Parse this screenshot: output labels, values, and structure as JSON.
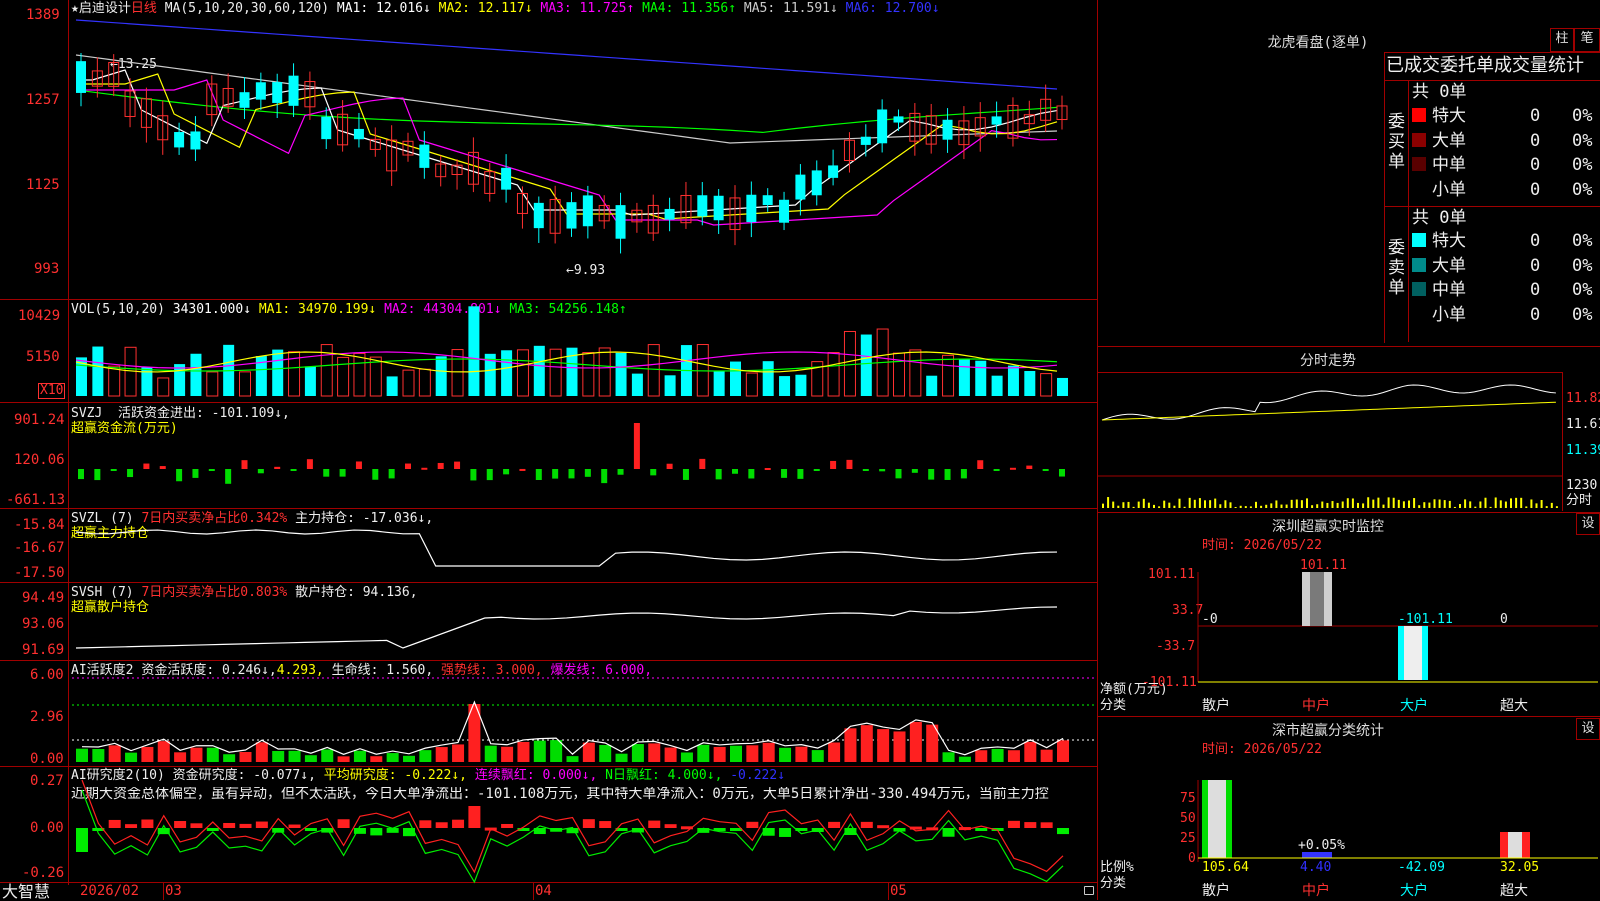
{
  "chart": {
    "stock_name": "启迪设计",
    "period": "日线",
    "ma_title": "MA(5,10,20,30,60,120)",
    "ma": [
      {
        "label": "MA1: 12.016↓",
        "color": "#ffffff"
      },
      {
        "label": "MA2: 12.117↓",
        "color": "#ffff00"
      },
      {
        "label": "MA3: 11.725↑",
        "color": "#ff00ff"
      },
      {
        "label": "MA4: 11.356↑",
        "color": "#00ff00"
      },
      {
        "label": "MA5: 11.591↓",
        "color": "#cccccc"
      },
      {
        "label": "MA6: 12.700↓",
        "color": "#3333ff"
      }
    ],
    "price_ticks": [
      "1389",
      "1257",
      "1125",
      "993"
    ],
    "high_mark": "13.25",
    "low_mark": "9.93",
    "vol_title": "VOL(5,10,20)",
    "vol_labels": [
      {
        "label": "34301.000↓",
        "color": "#ffffff"
      },
      {
        "label": "MA1: 34970.199↓",
        "color": "#ffff00"
      },
      {
        "label": "MA2: 44304.801↓",
        "color": "#ff00ff"
      },
      {
        "label": "MA3: 54256.148↑",
        "color": "#00ff00"
      }
    ],
    "vol_ticks": [
      "10429",
      "5150"
    ],
    "vol_unit": "X10",
    "svzj": {
      "title": "SVZJ",
      "label": "活跃资金进出: -101.109↓,",
      "name": "超赢资金流(万元)",
      "ticks": [
        "901.24",
        "120.06",
        "-661.13"
      ]
    },
    "svzl": {
      "title": "SVZL (7)",
      "ratio": "7日内买卖净占比0.342%",
      "label": "主力持仓: -17.036↓,",
      "name": "超赢主力持仓",
      "ticks": [
        "-15.84",
        "-16.67",
        "-17.50"
      ]
    },
    "svsh": {
      "title": "SVSH (7)",
      "ratio": "7日内买卖净占比0.803%",
      "label": "散户持仓: 94.136,",
      "name": "超赢散户持仓",
      "ticks": [
        "94.49",
        "93.06",
        "91.69"
      ]
    },
    "ai1": {
      "title": "AI活跃度2",
      "l1": "资金活跃度: 0.246↓,",
      "l2": "4.293,",
      "l3": "生命线: 1.560,",
      "l4": "强势线: 3.000,",
      "l5": "爆发线: 6.000,",
      "ticks": [
        "6.00",
        "2.96",
        "0.00"
      ]
    },
    "ai2": {
      "title": "AI研究度2(10)",
      "l1": "资金研究度: -0.077↓,",
      "l2": "平均研究度: -0.222↓,",
      "l3": "连续飘红: 0.000↓,",
      "l4": "N日飘红: 4.000↓,",
      "l5": "-0.222↓",
      "comment": "近期大资金总体偏空，虽有异动，但不太活跃，今日大单净流出：-101.108万元，其中特大单净流入：0万元，大单5日累计净出-330.494万元，当前主力控",
      "ticks": [
        "0.27",
        "0.00",
        "-0.26"
      ]
    },
    "dates": [
      "2026/02",
      "03",
      "04",
      "05"
    ],
    "brand": "大智慧"
  },
  "side": {
    "lhb_title": "龙虎看盘(逐单)",
    "btn_zhu": "柱",
    "btn_bi": "笔",
    "tabs": "已成交委托单成交量统计",
    "buy_vlabel": "委买单",
    "sell_vlabel": "委卖单",
    "buy_total": "共 0单",
    "sell_total": "共 0单",
    "buy_rows": [
      {
        "name": "特大",
        "val": "0",
        "pct": "0%",
        "color": "#ff0000"
      },
      {
        "name": "大单",
        "val": "0",
        "pct": "0%",
        "color": "#8b0000"
      },
      {
        "name": "中单",
        "val": "0",
        "pct": "0%",
        "color": "#5a0000"
      },
      {
        "name": "小单",
        "val": "0",
        "pct": "0%",
        "color": "#000000"
      }
    ],
    "sell_rows": [
      {
        "name": "特大",
        "val": "0",
        "pct": "0%",
        "color": "#00ffff"
      },
      {
        "name": "大单",
        "val": "0",
        "pct": "0%",
        "color": "#008b8b"
      },
      {
        "name": "中单",
        "val": "0",
        "pct": "0%",
        "color": "#006060"
      },
      {
        "name": "小单",
        "val": "0",
        "pct": "0%",
        "color": "#000000"
      }
    ],
    "fenshi_title": "分时走势",
    "fenshi_ticks": [
      "11.82",
      "11.61",
      "11.39"
    ],
    "fenshi_vol": "1230",
    "fenshi_tag": "分时",
    "sz_monitor_title": "深圳超赢实时监控",
    "sz_btn": "设",
    "sz_time": "时间: 2026/05/22",
    "sz_ticks": [
      "101.11",
      "33.7",
      "-33.7",
      "-101.11"
    ],
    "sz_values": [
      "-0",
      "101.11",
      "-101.11",
      "0"
    ],
    "sz_unit": "净额(万元)",
    "sz_cat_label": "分类",
    "sz_cats": [
      "散户",
      "中户",
      "大户",
      "超大"
    ],
    "stat_title": "深市超赢分类统计",
    "stat_btn": "设",
    "stat_time": "时间: 2026/05/22",
    "stat_ticks": [
      "75",
      "50",
      "25",
      "0"
    ],
    "stat_values": [
      "105.64",
      "4.40",
      "-42.09",
      "32.05"
    ],
    "stat_pct": "+0.05%",
    "stat_unit": "比例%",
    "stat_cat_label": "分类",
    "stat_cats": [
      "散户",
      "中户",
      "大户",
      "超大"
    ]
  }
}
